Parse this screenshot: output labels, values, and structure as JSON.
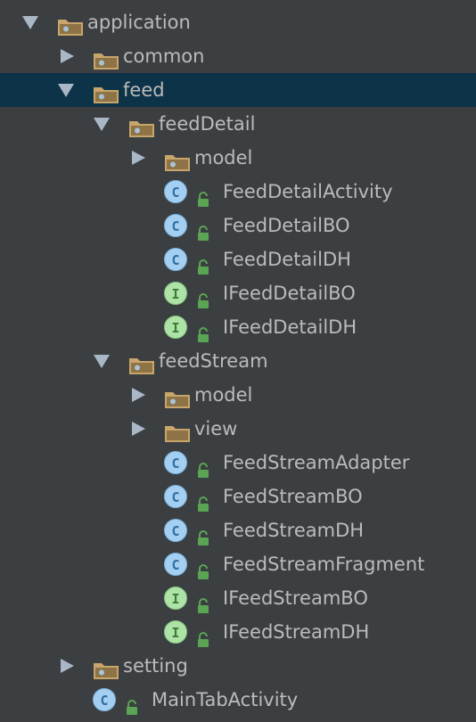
{
  "colors": {
    "background": "#3c3f41",
    "selected_row": "#0d3349",
    "text": "#bbbbbb",
    "folder": "#c8a56b",
    "class_badge": "#a5cff0",
    "interface_badge": "#aee3a8",
    "lock": "#5aa454"
  },
  "tree": {
    "application": {
      "label": "application",
      "icon": "folder-icon",
      "state": "expanded"
    },
    "common": {
      "label": "common",
      "icon": "folder-icon",
      "state": "collapsed"
    },
    "feed": {
      "label": "feed",
      "icon": "folder-icon",
      "state": "expanded",
      "selected": true
    },
    "feedDetail": {
      "label": "feedDetail",
      "icon": "folder-icon",
      "state": "expanded"
    },
    "feedDetail_model": {
      "label": "model",
      "icon": "folder-icon",
      "state": "collapsed"
    },
    "FeedDetailActivity": {
      "label": "FeedDetailActivity",
      "badge": "C",
      "icon": "class-icon"
    },
    "FeedDetailBO": {
      "label": "FeedDetailBO",
      "badge": "C",
      "icon": "class-icon"
    },
    "FeedDetailDH": {
      "label": "FeedDetailDH",
      "badge": "C",
      "icon": "class-icon"
    },
    "IFeedDetailBO": {
      "label": "IFeedDetailBO",
      "badge": "I",
      "icon": "interface-icon"
    },
    "IFeedDetailDH": {
      "label": "IFeedDetailDH",
      "badge": "I",
      "icon": "interface-icon"
    },
    "feedStream": {
      "label": "feedStream",
      "icon": "folder-icon",
      "state": "expanded"
    },
    "feedStream_model": {
      "label": "model",
      "icon": "folder-icon",
      "state": "collapsed"
    },
    "feedStream_view": {
      "label": "view",
      "icon": "folder-icon",
      "state": "collapsed"
    },
    "FeedStreamAdapter": {
      "label": "FeedStreamAdapter",
      "badge": "C",
      "icon": "class-icon"
    },
    "FeedStreamBO": {
      "label": "FeedStreamBO",
      "badge": "C",
      "icon": "class-icon"
    },
    "FeedStreamDH": {
      "label": "FeedStreamDH",
      "badge": "C",
      "icon": "class-icon"
    },
    "FeedStreamFragment": {
      "label": "FeedStreamFragment",
      "badge": "C",
      "icon": "class-icon"
    },
    "IFeedStreamBO": {
      "label": "IFeedStreamBO",
      "badge": "I",
      "icon": "interface-icon"
    },
    "IFeedStreamDH": {
      "label": "IFeedStreamDH",
      "badge": "I",
      "icon": "interface-icon"
    },
    "setting": {
      "label": "setting",
      "icon": "folder-icon",
      "state": "collapsed"
    },
    "MainTabActivity": {
      "label": "MainTabActivity",
      "badge": "C",
      "icon": "class-icon"
    }
  }
}
